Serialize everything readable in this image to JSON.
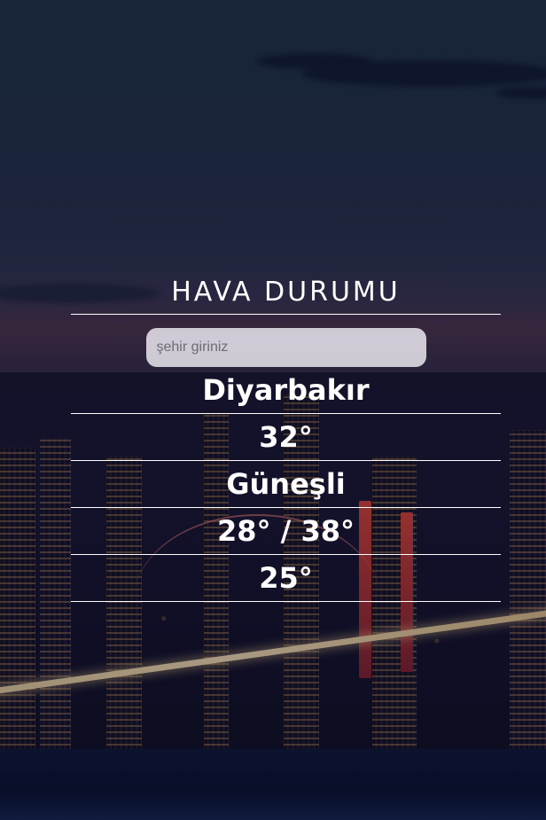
{
  "header": {
    "title": "HAVA DURUMU"
  },
  "search": {
    "placeholder": "şehir giriniz",
    "value": ""
  },
  "weather": {
    "city": "Diyarbakır",
    "temperature": "32°",
    "condition": "Güneşli",
    "min_max": "28° / 38°",
    "feels_like": "25°"
  },
  "colors": {
    "text": "#ffffff",
    "divider": "#ffffff",
    "input_bg": "#ebe8f0"
  }
}
